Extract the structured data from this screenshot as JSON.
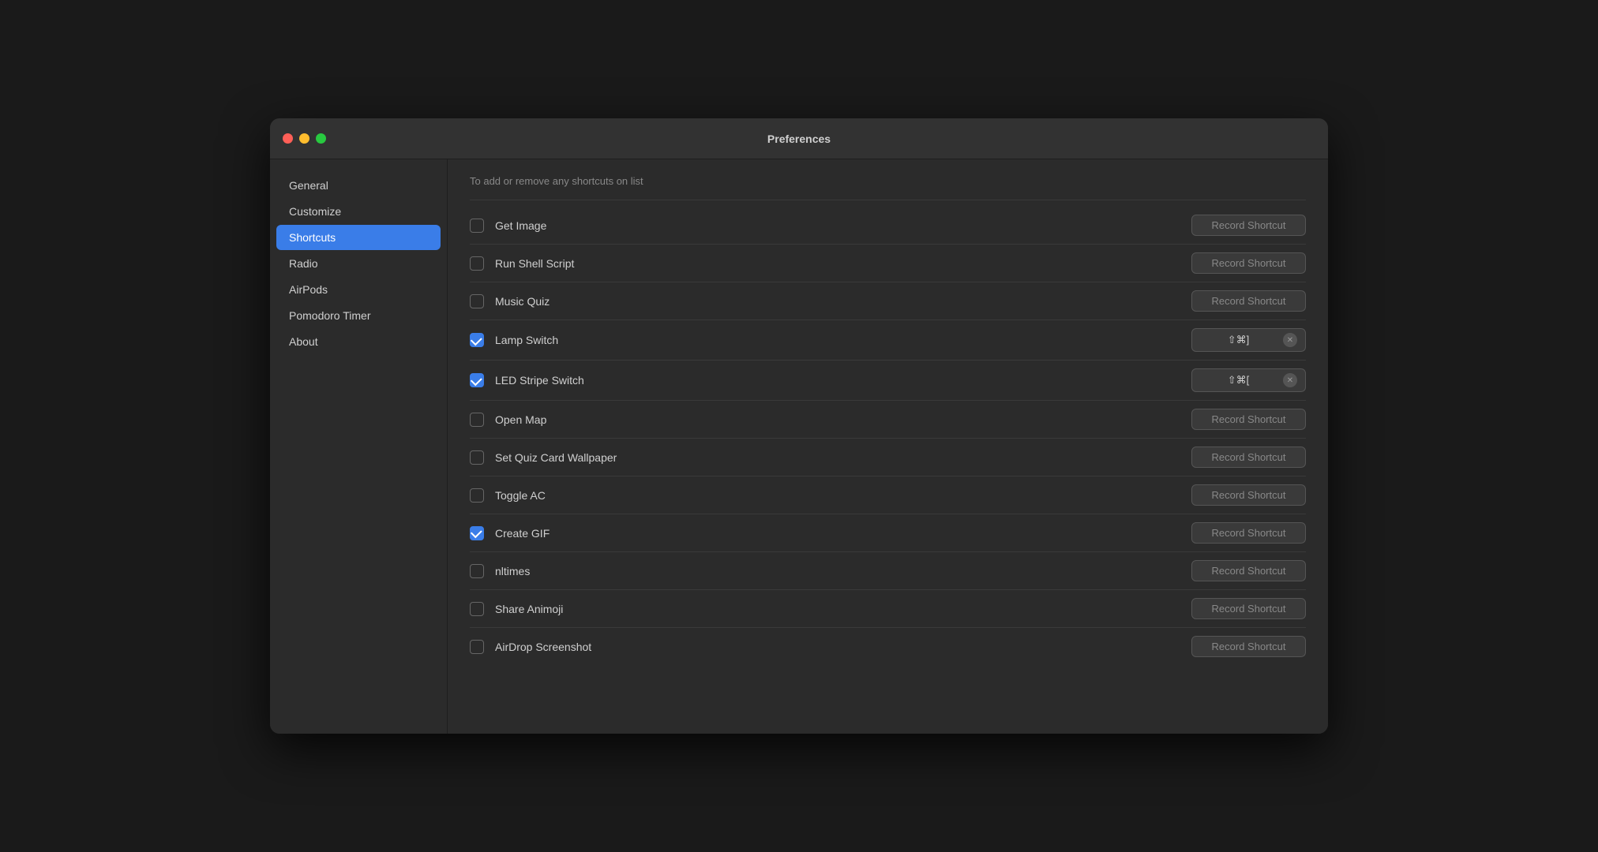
{
  "window": {
    "title": "Preferences"
  },
  "sidebar": {
    "items": [
      {
        "id": "general",
        "label": "General",
        "active": false
      },
      {
        "id": "customize",
        "label": "Customize",
        "active": false
      },
      {
        "id": "shortcuts",
        "label": "Shortcuts",
        "active": true
      },
      {
        "id": "radio",
        "label": "Radio",
        "active": false
      },
      {
        "id": "airpods",
        "label": "AirPods",
        "active": false
      },
      {
        "id": "pomodoro",
        "label": "Pomodoro Timer",
        "active": false
      },
      {
        "id": "about",
        "label": "About",
        "active": false
      }
    ]
  },
  "main": {
    "hint": "To add or remove any shortcuts on list",
    "shortcutRows": [
      {
        "id": "get-image",
        "name": "Get Image",
        "checked": false,
        "hasShortcut": false,
        "shortcut": null
      },
      {
        "id": "run-shell-script",
        "name": "Run Shell Script",
        "checked": false,
        "hasShortcut": false,
        "shortcut": null
      },
      {
        "id": "music-quiz",
        "name": "Music Quiz",
        "checked": false,
        "hasShortcut": false,
        "shortcut": null
      },
      {
        "id": "lamp-switch",
        "name": "Lamp Switch",
        "checked": true,
        "hasShortcut": true,
        "shortcut": "⇧⌘]"
      },
      {
        "id": "led-stripe-switch",
        "name": "LED Stripe Switch",
        "checked": true,
        "hasShortcut": true,
        "shortcut": "⇧⌘["
      },
      {
        "id": "open-map",
        "name": "Open Map",
        "checked": false,
        "hasShortcut": false,
        "shortcut": null
      },
      {
        "id": "set-quiz-card-wallpaper",
        "name": "Set Quiz Card Wallpaper",
        "checked": false,
        "hasShortcut": false,
        "shortcut": null
      },
      {
        "id": "toggle-ac",
        "name": "Toggle AC",
        "checked": false,
        "hasShortcut": false,
        "shortcut": null
      },
      {
        "id": "create-gif",
        "name": "Create GIF",
        "checked": true,
        "hasShortcut": false,
        "shortcut": null
      },
      {
        "id": "nltimes",
        "name": "nltimes",
        "checked": false,
        "hasShortcut": false,
        "shortcut": null
      },
      {
        "id": "share-animoji",
        "name": "Share Animoji",
        "checked": false,
        "hasShortcut": false,
        "shortcut": null
      },
      {
        "id": "airdrop-screenshot",
        "name": "AirDrop Screenshot",
        "checked": false,
        "hasShortcut": false,
        "shortcut": null
      }
    ],
    "recordLabel": "Record Shortcut"
  }
}
